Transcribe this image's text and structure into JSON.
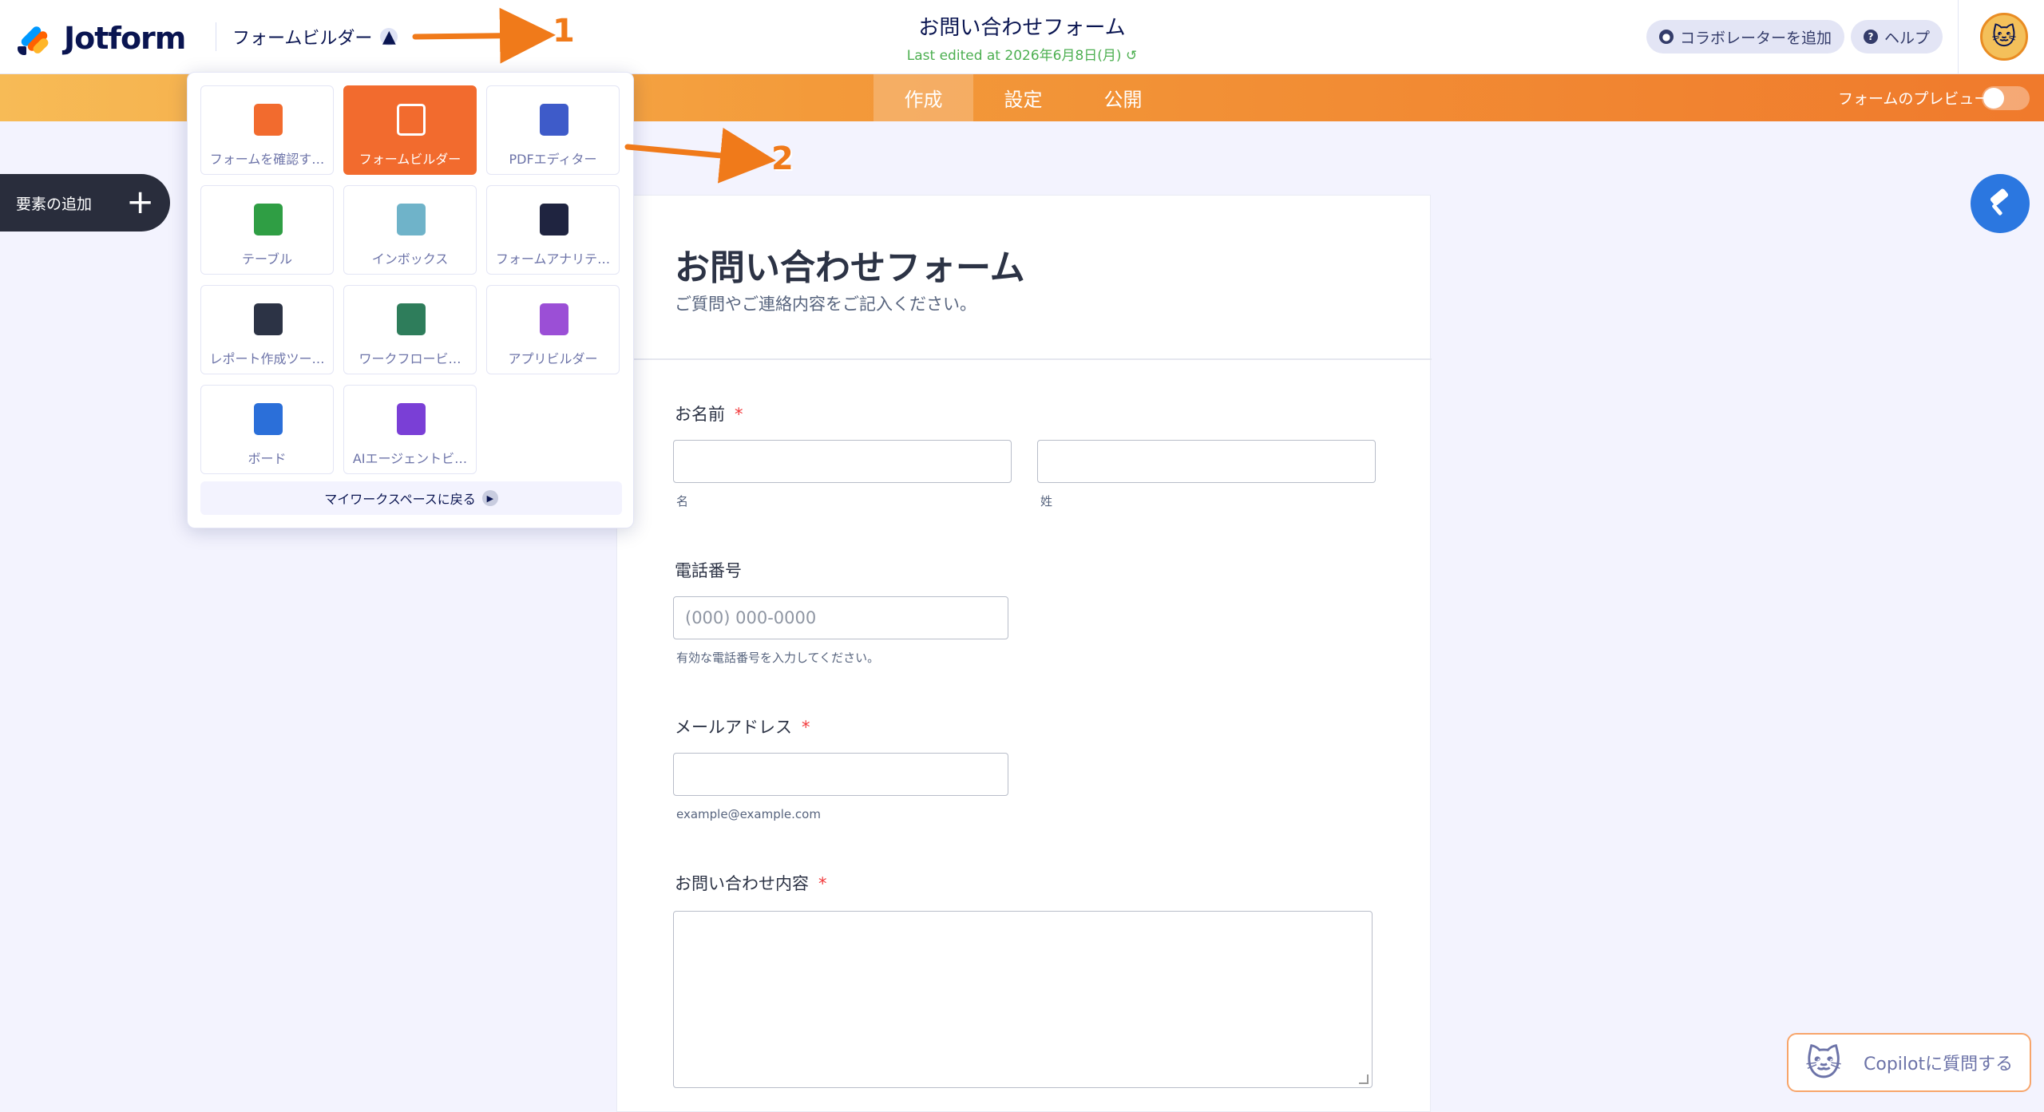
{
  "header": {
    "logo_text": "Jotform",
    "product_switch_label": "フォームビルダー",
    "form_title": "お問い合わせフォーム",
    "last_edited": "Last edited at 2026年6月8日(月)",
    "collaborator_label": "コラボレーターを追加",
    "help_label": "ヘルプ"
  },
  "nav": {
    "tabs": [
      {
        "label": "作成"
      },
      {
        "label": "設定"
      },
      {
        "label": "公開"
      }
    ],
    "preview_label": "フォームのプレビュー"
  },
  "left_panel": {
    "add_element_label": "要素の追加"
  },
  "app_switcher": {
    "items": [
      {
        "label": "フォームを確認す…",
        "icon": "form-review-icon",
        "color": "#f26b2e"
      },
      {
        "label": "フォームビルダー",
        "icon": "form-builder-icon",
        "color": "#ffffff"
      },
      {
        "label": "PDFエディター",
        "icon": "pdf-editor-icon",
        "color": "#3e5bc9"
      },
      {
        "label": "テーブル",
        "icon": "table-icon",
        "color": "#2f9e44"
      },
      {
        "label": "インボックス",
        "icon": "inbox-icon",
        "color": "#6fb3c9"
      },
      {
        "label": "フォームアナリテ…",
        "icon": "analytics-icon",
        "color": "#1f2440"
      },
      {
        "label": "レポート作成ツー…",
        "icon": "report-icon",
        "color": "#2c3345"
      },
      {
        "label": "ワークフロービ…",
        "icon": "workflow-icon",
        "color": "#2e7d5b"
      },
      {
        "label": "アプリビルダー",
        "icon": "app-builder-icon",
        "color": "#9b4fd6"
      },
      {
        "label": "ボード",
        "icon": "board-icon",
        "color": "#2b6fd9"
      },
      {
        "label": "AIエージェントビ…",
        "icon": "ai-agent-icon",
        "color": "#7a3fd6"
      }
    ],
    "back_to_workspace": "マイワークスペースに戻る"
  },
  "annotations": {
    "label_1": "1",
    "label_2": "2"
  },
  "form": {
    "title": "お問い合わせフォーム",
    "subtitle": "ご質問やご連絡内容をご記入ください。",
    "name_label": "お名前",
    "required_mark": "*",
    "first_name_sub": "名",
    "last_name_sub": "姓",
    "phone_label": "電話番号",
    "phone_placeholder": "(000) 000-0000",
    "phone_hint": "有効な電話番号を入力してください。",
    "email_label": "メールアドレス",
    "email_hint": "example@example.com",
    "message_label": "お問い合わせ内容"
  },
  "copilot": {
    "label": "Copilotに質問する"
  },
  "colors": {
    "accent_orange": "#f07a2c",
    "nav_gradient_start": "#f7bb56",
    "primary_blue": "#2b77e0",
    "required_red": "#f23a3c",
    "last_edited_green": "#4caf50"
  }
}
